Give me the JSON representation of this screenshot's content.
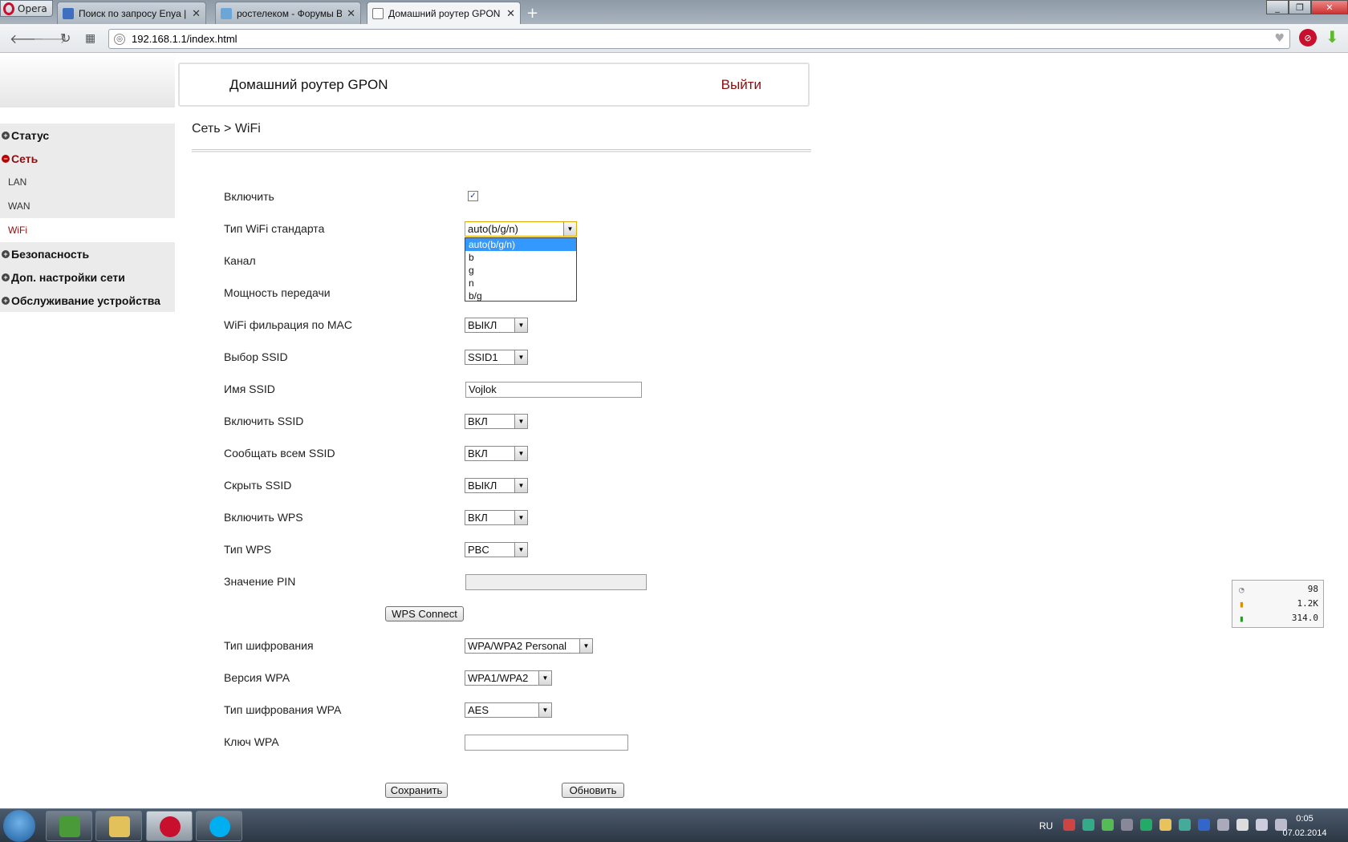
{
  "browser": {
    "menu_label": "Opera",
    "tabs": [
      {
        "title": "Поиск по запросу Enya | В"
      },
      {
        "title": "ростелеком - Форумы Ве"
      },
      {
        "title": "Домашний роутер GPON"
      }
    ],
    "url": "192.168.1.1/index.html"
  },
  "header": {
    "title": "Домашний роутер GPON",
    "logout": "Выйти"
  },
  "sidebar": {
    "items": [
      {
        "label": "Статус",
        "type": "category",
        "open": false
      },
      {
        "label": "Сеть",
        "type": "category",
        "open": true
      },
      {
        "label": "LAN",
        "type": "sub"
      },
      {
        "label": "WAN",
        "type": "sub"
      },
      {
        "label": "WiFi",
        "type": "sub",
        "selected": true
      },
      {
        "label": "Безопасность",
        "type": "category",
        "open": false
      },
      {
        "label": "Доп. настройки сети",
        "type": "category",
        "open": false
      },
      {
        "label": "Обслуживание устройства",
        "type": "category",
        "open": false
      }
    ]
  },
  "breadcrumb": "Сеть > WiFi",
  "form": {
    "enable_label": "Включить",
    "enable_checked": true,
    "wifi_standard_label": "Тип WiFi стандарта",
    "wifi_standard_value": "auto(b/g/n)",
    "wifi_standard_options": [
      "auto(b/g/n)",
      "b",
      "g",
      "n",
      "b/g"
    ],
    "channel_label": "Канал",
    "power_label": "Мощность передачи",
    "mac_filter_label": "WiFi фильрация по MAC",
    "mac_filter_value": "ВЫКЛ",
    "ssid_select_label": "Выбор SSID",
    "ssid_select_value": "SSID1",
    "ssid_name_label": "Имя SSID",
    "ssid_name_value": "Vojlok",
    "enable_ssid_label": "Включить SSID",
    "enable_ssid_value": "ВКЛ",
    "broadcast_ssid_label": "Сообщать всем SSID",
    "broadcast_ssid_value": "ВКЛ",
    "hide_ssid_label": "Скрыть SSID",
    "hide_ssid_value": "ВЫКЛ",
    "enable_wps_label": "Включить WPS",
    "enable_wps_value": "ВКЛ",
    "wps_type_label": "Тип WPS",
    "wps_type_value": "PBC",
    "pin_label": "Значение PIN",
    "pin_value": "",
    "wps_connect": "WPS Connect",
    "encryption_label": "Тип шифрования",
    "encryption_value": "WPA/WPA2 Personal",
    "wpa_version_label": "Версия WPA",
    "wpa_version_value": "WPA1/WPA2",
    "wpa_cipher_label": "Тип шифрования WPA",
    "wpa_cipher_value": "AES",
    "wpa_key_label": "Ключ WPA",
    "wpa_key_value": "",
    "save": "Сохранить",
    "refresh": "Обновить"
  },
  "widget": {
    "v1": "98",
    "v2": "1.2K",
    "v3": "314.0"
  },
  "taskbar": {
    "lang": "RU",
    "time": "0:05",
    "date": "07.02.2014"
  }
}
